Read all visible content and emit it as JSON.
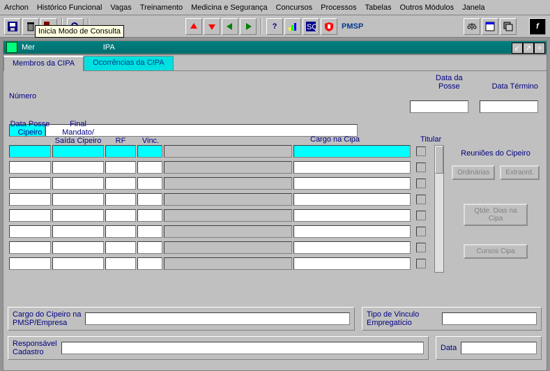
{
  "menu": [
    "Archon",
    "Histórico Funcional",
    "Vagas",
    "Treinamento",
    "Medicina e Segurança",
    "Concursos",
    "Processos",
    "Tabelas",
    "Outros Módulos",
    "Janela"
  ],
  "toolbar": {
    "pmsp": "PMSP",
    "tooltip": "Inicia Modo de Consulta"
  },
  "window": {
    "title_partial": "IPA"
  },
  "tabs": {
    "active": "Membros da CIPA",
    "other": "Ocorrências da CIPA"
  },
  "top": {
    "numero_label": "Número",
    "posse_label1": "Data da",
    "posse_label2": "Posse",
    "termino_label": "Data Término",
    "numero_value": "",
    "numero_desc": "",
    "posse_value": "",
    "termino_value": ""
  },
  "grid_headers": {
    "h1a": "Data Posse",
    "h1b": "Cipeiro",
    "h2a": "Final",
    "h2b": "Mandato/",
    "h2c": "Saída Cipeiro",
    "h3": "RF",
    "h4": "Vinc.",
    "cargo": "Cargo na Cipa",
    "titular": "Titular"
  },
  "rpanel": {
    "title": "Reuniões do Cipeiro",
    "ord": "Ordinárias",
    "ext": "Extraord.",
    "qtde": "Qtde. Dias na Cipa",
    "cursos": "Cursos Cipa"
  },
  "bottom": {
    "cargo_lbl1": "Cargo do Cipeiro na",
    "cargo_lbl2": "PMSP/Empresa",
    "cargo_val": "",
    "tipo_lbl": "Tipo de Vinculo Empregatício",
    "tipo_val": "",
    "resp_lbl1": "Responsável",
    "resp_lbl2": "Cadastro",
    "resp_val": "",
    "data_lbl": "Data",
    "data_val": ""
  },
  "grid_rows": 8
}
